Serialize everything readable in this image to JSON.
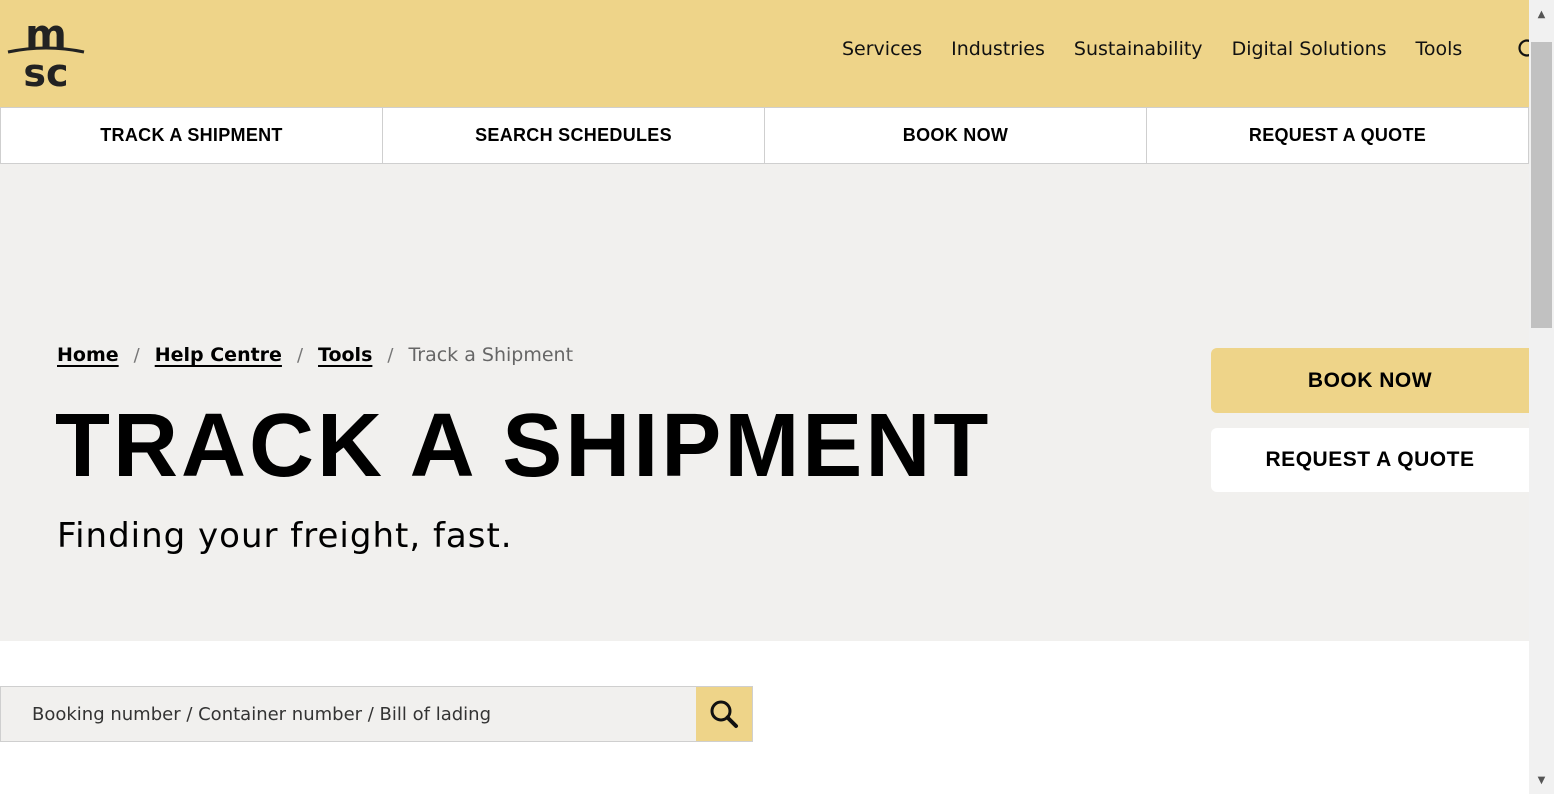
{
  "header": {
    "logo_text": "msc",
    "nav": [
      {
        "label": "Services"
      },
      {
        "label": "Industries"
      },
      {
        "label": "Sustainability"
      },
      {
        "label": "Digital Solutions"
      },
      {
        "label": "Tools"
      }
    ],
    "search_icon": "search-icon"
  },
  "quickbar": {
    "items": [
      {
        "label": "TRACK A SHIPMENT"
      },
      {
        "label": "SEARCH SCHEDULES"
      },
      {
        "label": "BOOK NOW"
      },
      {
        "label": "REQUEST A QUOTE"
      }
    ]
  },
  "breadcrumb": {
    "items": [
      {
        "label": "Home"
      },
      {
        "label": "Help Centre"
      },
      {
        "label": "Tools"
      }
    ],
    "separator": "/",
    "current": "Track a Shipment"
  },
  "hero": {
    "title": "TRACK A SHIPMENT",
    "subtitle": "Finding your freight, fast.",
    "book_button": "BOOK NOW",
    "quote_button": "REQUEST A QUOTE"
  },
  "search": {
    "placeholder": "Booking number / Container number / Bill of lading",
    "value": "",
    "button_icon": "magnifier-icon"
  },
  "colors": {
    "brand_yellow": "#eed489",
    "hero_background": "#f1f0ee"
  }
}
